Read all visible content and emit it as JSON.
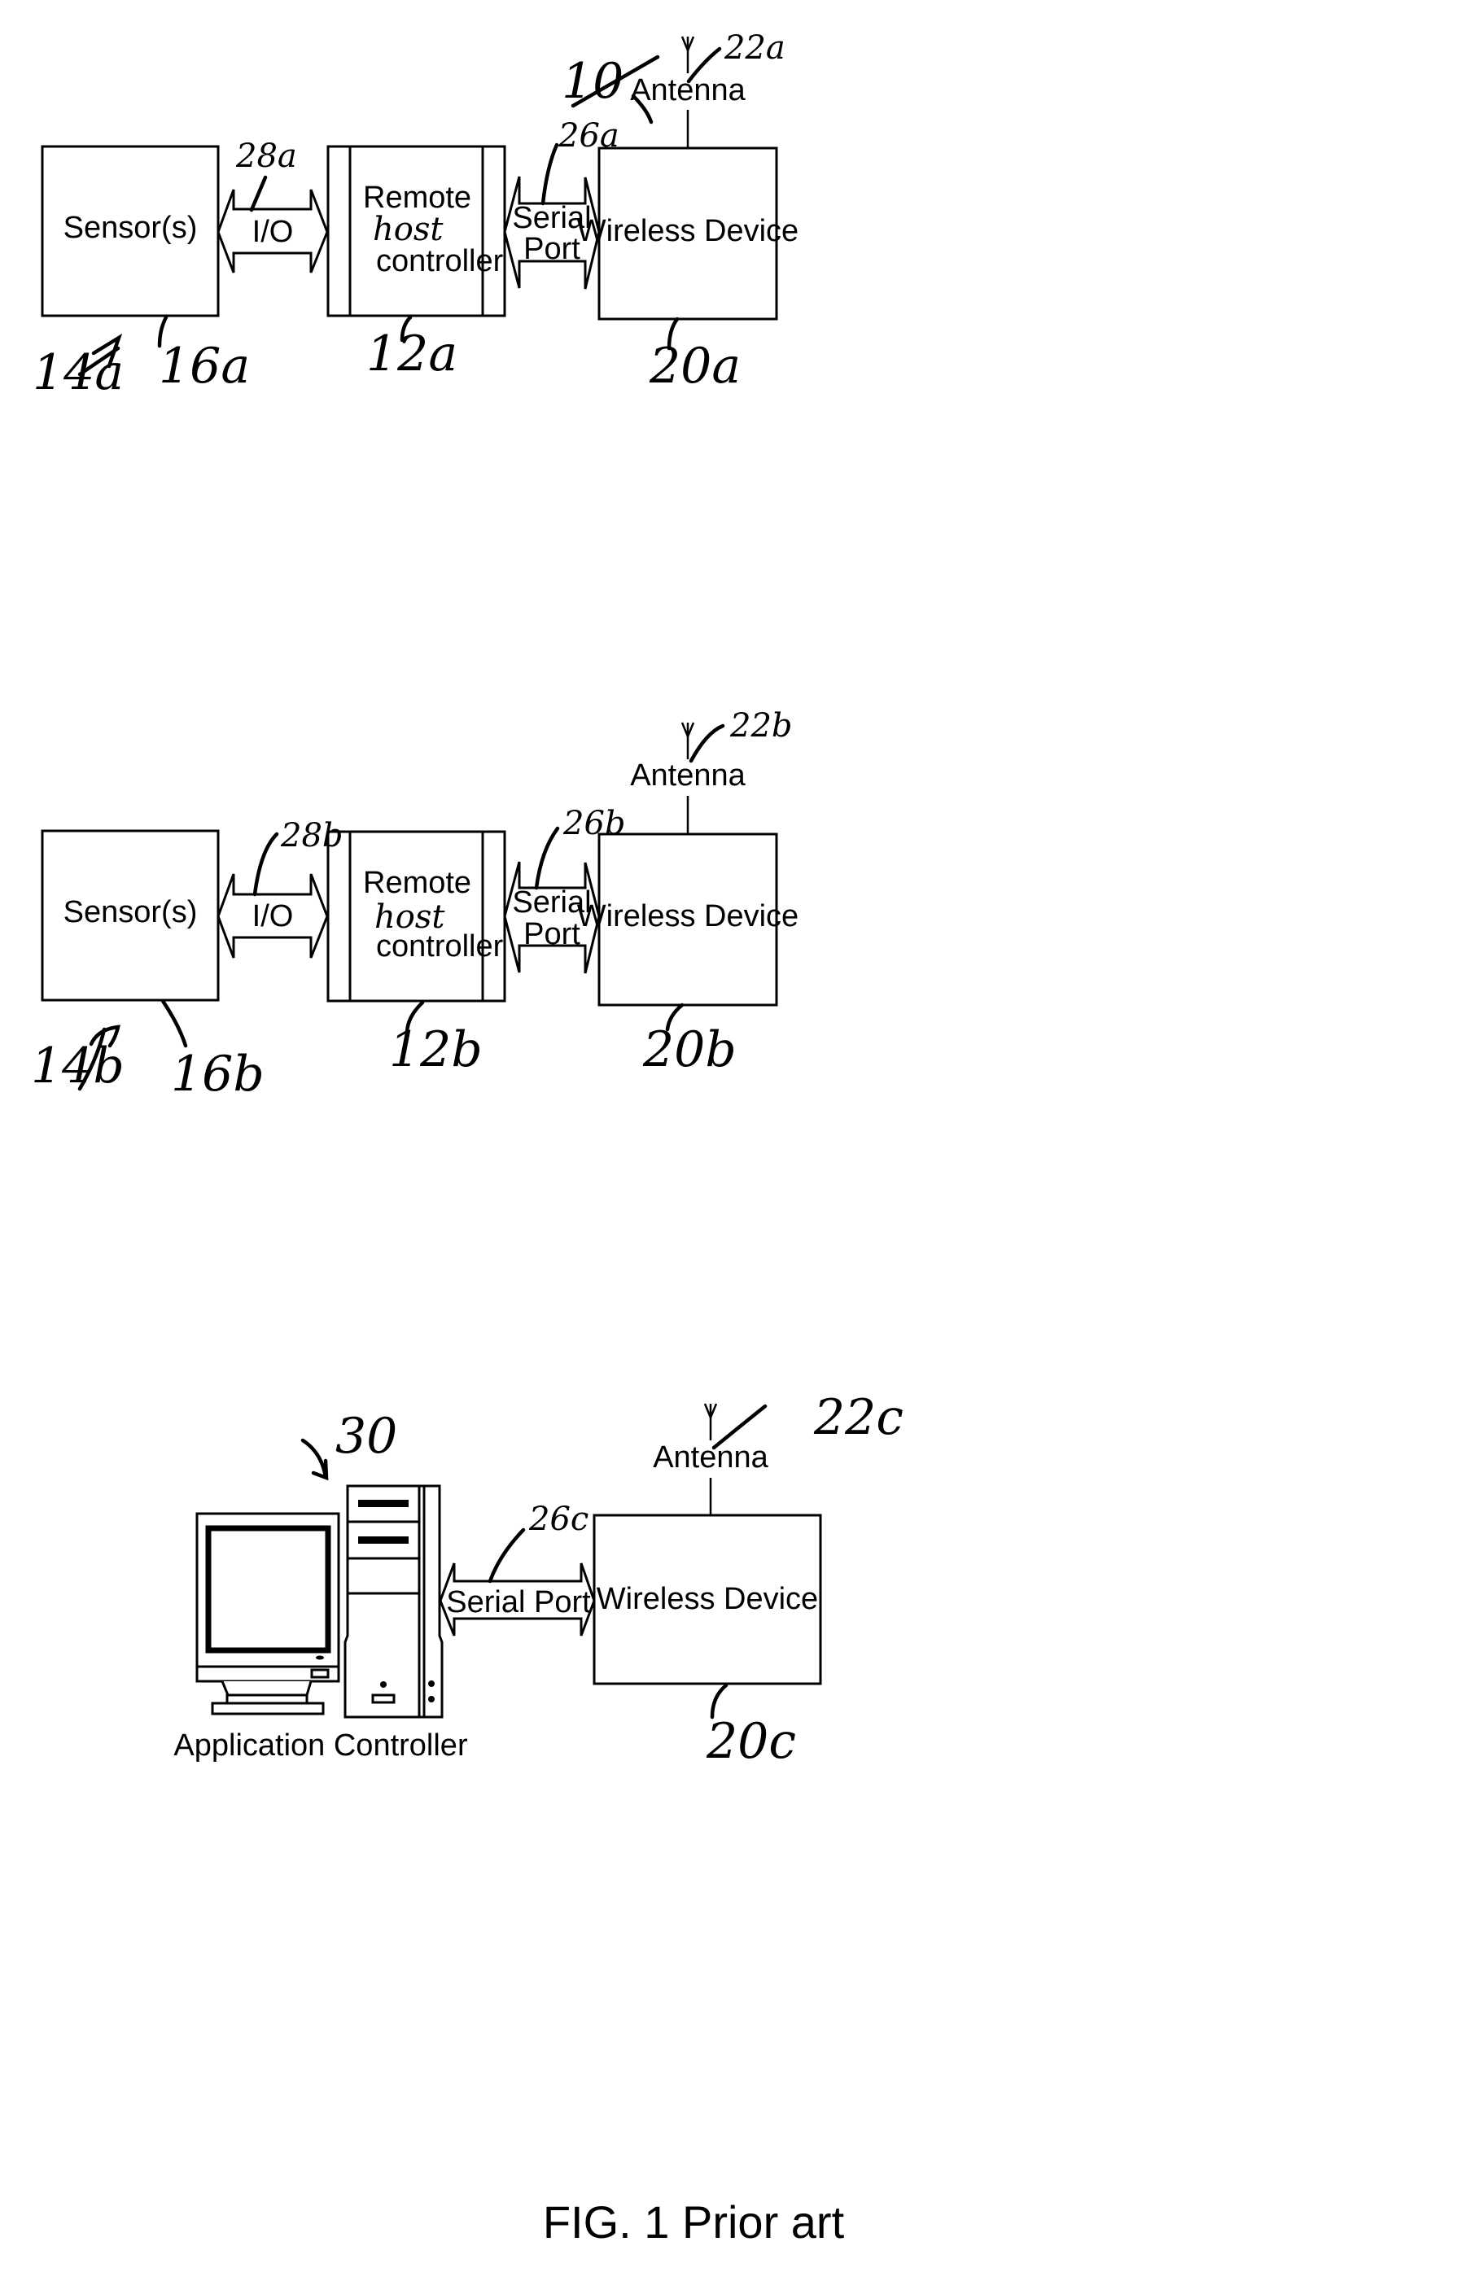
{
  "figure": {
    "ref": "10",
    "caption": "FIG. 1  Prior art"
  },
  "rows": [
    {
      "group_ref": "14a",
      "sensor": {
        "label": "Sensor(s)",
        "ref": "16a"
      },
      "io": {
        "label": "I/O",
        "ref": "28a"
      },
      "controller": {
        "line1": "Remote",
        "line2": "host",
        "line3": "controller",
        "ref": "12a"
      },
      "serial": {
        "line1": "Serial",
        "line2": "Port",
        "ref": "26a"
      },
      "wireless": {
        "label": "Wireless Device",
        "ref": "20a"
      },
      "antenna": {
        "label": "Antenna",
        "ref": "22a"
      }
    },
    {
      "group_ref": "14b",
      "sensor": {
        "label": "Sensor(s)",
        "ref": "16b"
      },
      "io": {
        "label": "I/O",
        "ref": "28b"
      },
      "controller": {
        "line1": "Remote",
        "line2": "host",
        "line3": "controller",
        "ref": "12b"
      },
      "serial": {
        "line1": "Serial",
        "line2": "Port",
        "ref": "26b"
      },
      "wireless": {
        "label": "Wireless Device",
        "ref": "20b"
      },
      "antenna": {
        "label": "Antenna",
        "ref": "22b"
      }
    }
  ],
  "bottom": {
    "computer": {
      "label": "Application Controller",
      "ref": "30"
    },
    "serial": {
      "label": "Serial Port",
      "ref": "26c"
    },
    "wireless": {
      "label": "Wireless Device",
      "ref": "20c"
    },
    "antenna": {
      "label": "Antenna",
      "ref": "22c"
    }
  }
}
